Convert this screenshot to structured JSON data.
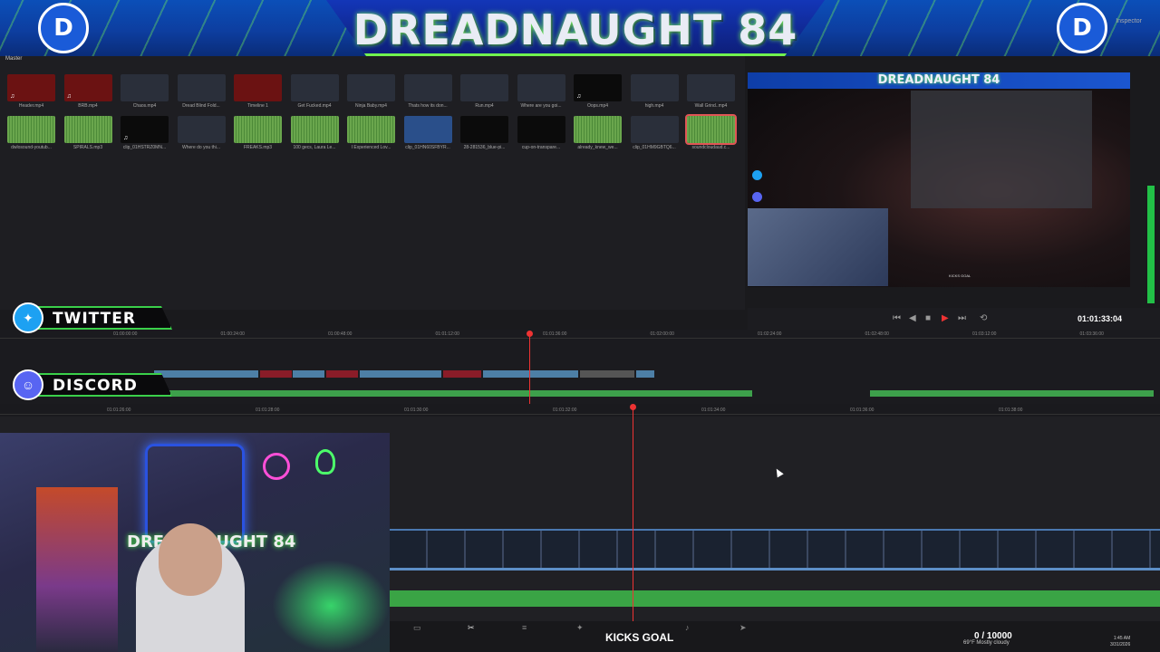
{
  "banner": {
    "title": "DREADNAUGHT 84",
    "logo_left": "D",
    "logo_right": "D",
    "inspector_label": "Inspector"
  },
  "media_pool": {
    "title": "Master",
    "row1": [
      {
        "name": "Header.mp4",
        "kind": "red",
        "note": "♫"
      },
      {
        "name": "BRB.mp4",
        "kind": "red",
        "note": "♫"
      },
      {
        "name": "Chaos.mp4",
        "kind": "dark",
        "note": ""
      },
      {
        "name": "Dread Blind Fold...",
        "kind": "dark",
        "note": ""
      },
      {
        "name": "Timeline 1",
        "kind": "red",
        "note": ""
      },
      {
        "name": "Get Fucked.mp4",
        "kind": "dark",
        "note": ""
      },
      {
        "name": "Ninja Baby.mp4",
        "kind": "dark",
        "note": ""
      },
      {
        "name": "Thats how its don...",
        "kind": "dark",
        "note": ""
      },
      {
        "name": "Run.mp4",
        "kind": "dark",
        "note": ""
      },
      {
        "name": "Where are you goi...",
        "kind": "dark",
        "note": ""
      },
      {
        "name": "Oops.mp4",
        "kind": "black",
        "note": "♫"
      },
      {
        "name": "high.mp4",
        "kind": "dark",
        "note": ""
      },
      {
        "name": "Wall Grind..mp4",
        "kind": "dark",
        "note": ""
      }
    ],
    "row2": [
      {
        "name": "dwlosound-youtub...",
        "kind": "audio",
        "note": ""
      },
      {
        "name": "SPIRALS.mp3",
        "kind": "audio",
        "note": ""
      },
      {
        "name": "clip_01HSTRZ0MN...",
        "kind": "black",
        "note": "♫"
      },
      {
        "name": "Where do you thi...",
        "kind": "dark",
        "note": ""
      },
      {
        "name": "FREAKS.mp3",
        "kind": "audio",
        "note": ""
      },
      {
        "name": "100 gecs, Laura Le...",
        "kind": "audio",
        "note": ""
      },
      {
        "name": "I Experienced Lov...",
        "kind": "audio",
        "note": ""
      },
      {
        "name": "clip_01HN60SFBYR...",
        "kind": "blue",
        "note": ""
      },
      {
        "name": "28-281536_blue-pi...",
        "kind": "black",
        "note": ""
      },
      {
        "name": "cup-on-transpare...",
        "kind": "black",
        "note": ""
      },
      {
        "name": "already_knew_we...",
        "kind": "audio",
        "note": ""
      },
      {
        "name": "clip_01HM9GBTQ6...",
        "kind": "dark",
        "note": ""
      },
      {
        "name": "soundcloudaud.c...",
        "kind": "audio",
        "note": ""
      }
    ]
  },
  "viewer": {
    "overlay_title": "DREADNAUGHT 84",
    "ingame_label": "KICKS GOAL",
    "timecode": "01:01:33:04",
    "controls": {
      "prev": "⏮",
      "back": "◀",
      "stop": "■",
      "play": "▶",
      "next": "⏭",
      "loop": "⟲"
    }
  },
  "upper_timeline": {
    "ticks": [
      "01:00:00:00",
      "01:00:24:00",
      "01:00:48:00",
      "01:01:12:00",
      "01:01:36:00",
      "01:02:00:00",
      "01:02:24:00",
      "01:02:48:00",
      "01:03:12:00",
      "01:03:36:00"
    ]
  },
  "lower_timeline": {
    "ticks": [
      "01:01:26:00",
      "01:01:28:00",
      "01:01:30:00",
      "01:01:32:00",
      "01:01:34:00",
      "01:01:36:00",
      "01:01:38:00"
    ]
  },
  "social": {
    "twitter": "TWITTER",
    "discord": "DISCORD"
  },
  "overlay": {
    "kicks_goal": "KICKS GOAL",
    "counter": "0 / 10000"
  },
  "taskbar": {
    "weather": "69°F Mostly cloudy",
    "time": "1:45 AM",
    "date": "3/31/2026"
  },
  "colors": {
    "accent_green": "#3da04b",
    "playhead_red": "#e33333",
    "brand_blue": "#1a5bd8"
  }
}
